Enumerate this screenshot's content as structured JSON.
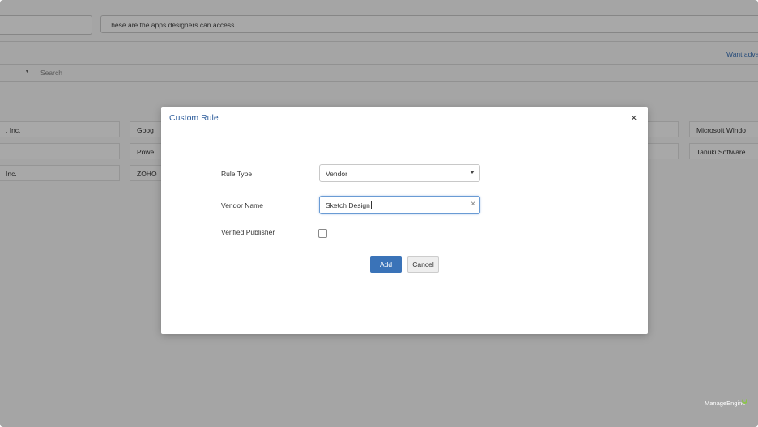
{
  "background": {
    "description_field_value": "These are the apps designers can access",
    "advanced_link": "Want adva",
    "search_placeholder": "Search",
    "grid_cells": [
      {
        "text": ", Inc."
      },
      {
        "text": "Goog"
      },
      {
        "text": "Microsoft Windo"
      },
      {
        "text": "Powe"
      },
      {
        "text": "Tanuki Software"
      },
      {
        "text": "Inc."
      },
      {
        "text": "ZOHO"
      }
    ]
  },
  "modal": {
    "title": "Custom Rule",
    "close_glyph": "×",
    "rule_type_label": "Rule Type",
    "rule_type_value": "Vendor",
    "vendor_name_label": "Vendor Name",
    "vendor_name_value": "Sketch Design",
    "clear_glyph": "×",
    "verified_publisher_label": "Verified Publisher",
    "verified_publisher_checked": false,
    "add_label": "Add",
    "cancel_label": "Cancel"
  },
  "watermark": "ManageEngine",
  "colors": {
    "accent": "#3a73b8",
    "title_blue": "#2f5e9c",
    "link_blue": "#3b73b9"
  }
}
